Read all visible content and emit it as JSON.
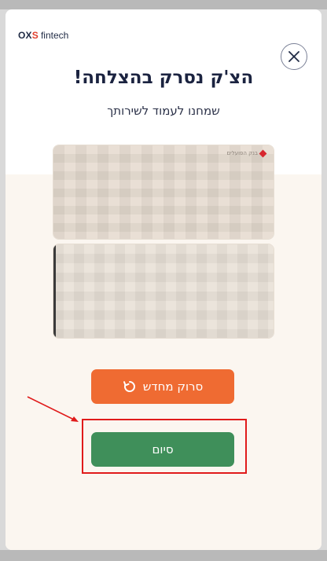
{
  "brand": {
    "mark_prefix": "OX",
    "mark_x": "S",
    "name": "fintech"
  },
  "header": {
    "title": "הצ'ק נסרק בהצלחה!",
    "subtitle": "שמחנו לעמוד לשירותך"
  },
  "cheque": {
    "bank_name": "בנק הפועלים"
  },
  "buttons": {
    "rescan_label": "סרוק מחדש",
    "finish_label": "סיום"
  },
  "icons": {
    "close": "close-icon",
    "rescan": "refresh-icon"
  },
  "colors": {
    "rescan": "#ef6b32",
    "finish": "#3f8f5a",
    "highlight": "#e01b1b"
  }
}
